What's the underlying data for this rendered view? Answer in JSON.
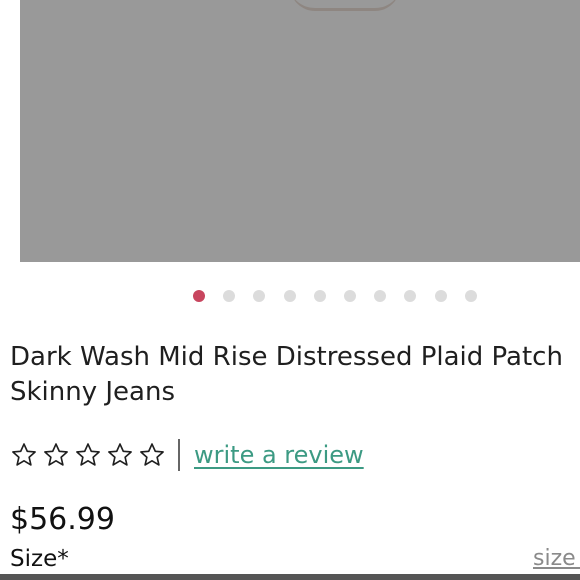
{
  "product": {
    "title": "Dark Wash Mid Rise Distressed Plaid Patch Skinny Jeans",
    "price": "$56.99",
    "rating": {
      "stars": 0,
      "max_stars": 5
    },
    "review_link_label": "write a review",
    "size_label": "Size*",
    "size_guide_label": "size g"
  },
  "carousel": {
    "dot_count": 10,
    "active_index": 0,
    "active_color": "#c8455e",
    "inactive_color": "#dcdcdc"
  },
  "colors": {
    "image_placeholder": "#999999",
    "link": "#3c9a83"
  },
  "icons": {
    "star": "star-outline-icon"
  }
}
